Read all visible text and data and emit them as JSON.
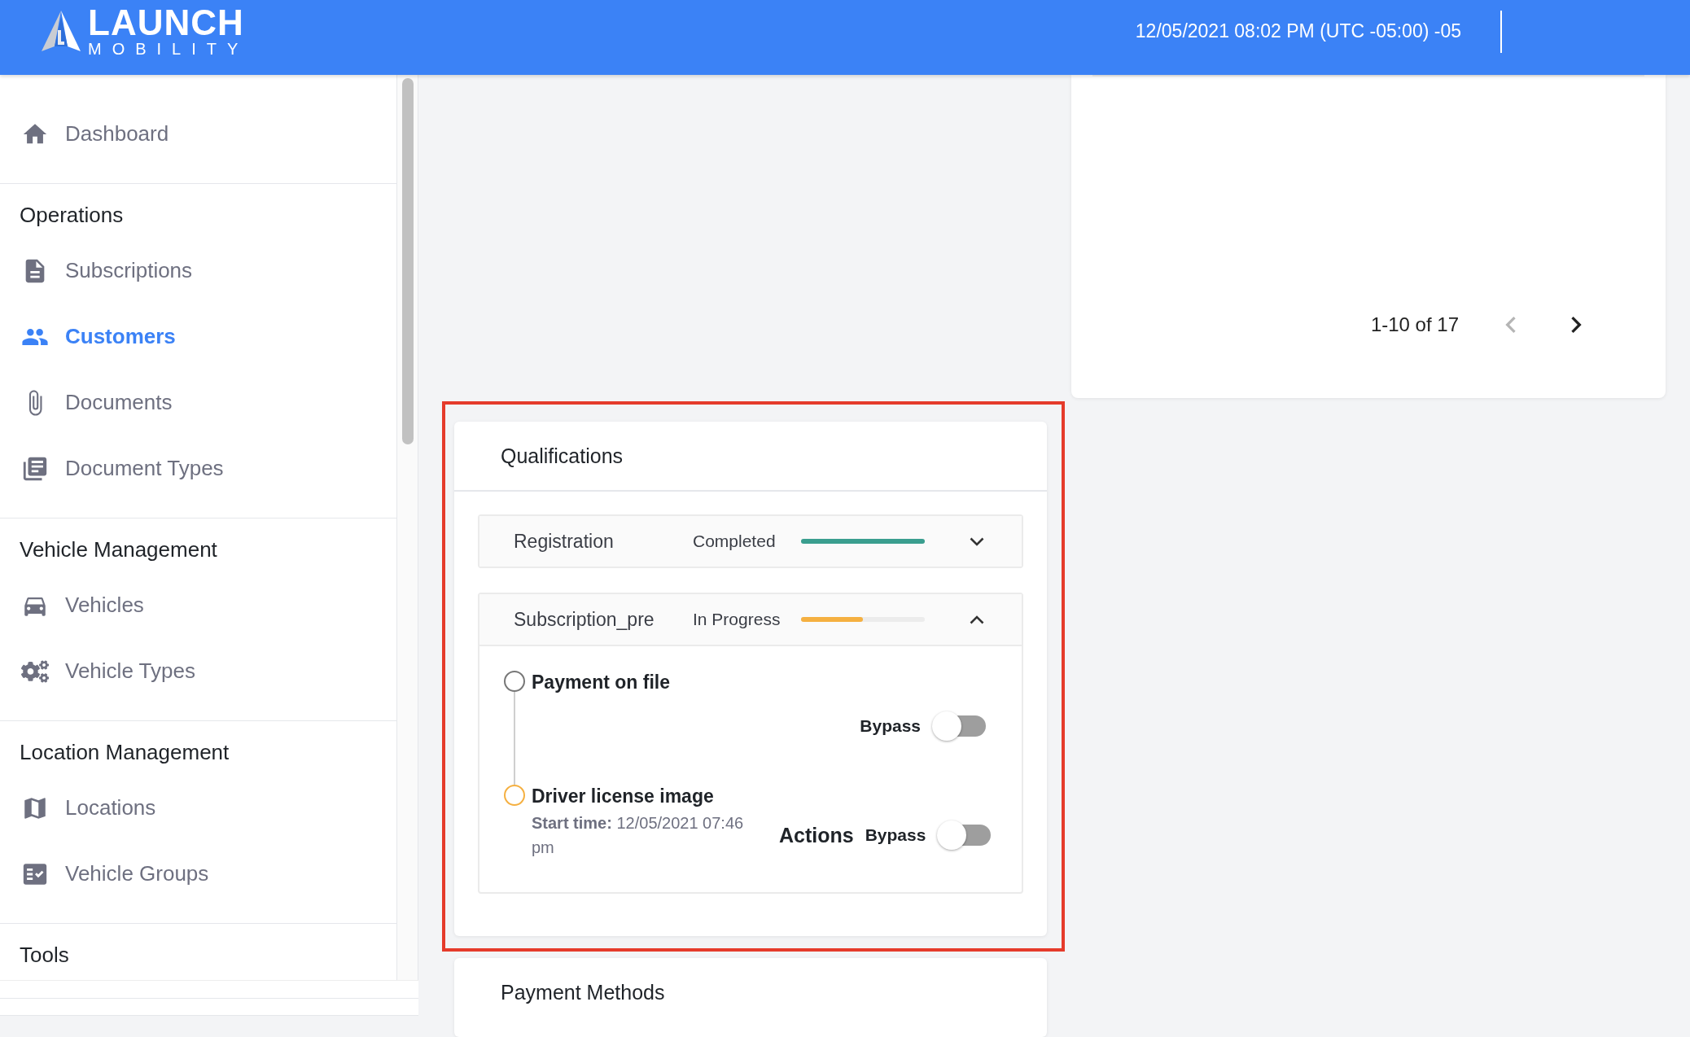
{
  "header": {
    "logo": {
      "word": "LAUNCH",
      "subword": "MOBILITY"
    },
    "datetime": "12/05/2021 08:02 PM (UTC -05:00) -05"
  },
  "sidebar": {
    "groups": [
      {
        "items": [
          {
            "label": "Dashboard",
            "selected": false
          }
        ]
      },
      {
        "title": "Operations",
        "items": [
          {
            "label": "Subscriptions",
            "selected": false
          },
          {
            "label": "Customers",
            "selected": true
          },
          {
            "label": "Documents",
            "selected": false
          },
          {
            "label": "Document Types",
            "selected": false
          }
        ]
      },
      {
        "title": "Vehicle Management",
        "items": [
          {
            "label": "Vehicles",
            "selected": false
          },
          {
            "label": "Vehicle Types",
            "selected": false
          }
        ]
      },
      {
        "title": "Location Management",
        "items": [
          {
            "label": "Locations",
            "selected": false
          },
          {
            "label": "Vehicle Groups",
            "selected": false
          }
        ]
      },
      {
        "title": "Tools"
      }
    ]
  },
  "table_card": {
    "pagination": {
      "range": "1-10 of 17",
      "prev_disabled": true,
      "next_disabled": false
    }
  },
  "qualifications": {
    "title": "Qualifications",
    "stages": [
      {
        "name": "Registration",
        "status": "Completed",
        "level": 1,
        "color": "#3a9e8f",
        "expanded": false
      },
      {
        "name": "Subscription_pre",
        "status": "In Progress",
        "level": 0.5,
        "color": "#f5b041",
        "expanded": true,
        "steps": [
          {
            "title": "Payment on file",
            "active": false,
            "bypass_label": "Bypass",
            "bypass_on": false
          },
          {
            "title": "Driver license image",
            "active": true,
            "start_time": "**Start time:** 12/05/2021 07:46 pm",
            "actions_label": "Actions",
            "bypass_label": "Bypass",
            "bypass_on": false
          }
        ]
      }
    ]
  },
  "payment_methods": {
    "title": "Payment Methods"
  }
}
